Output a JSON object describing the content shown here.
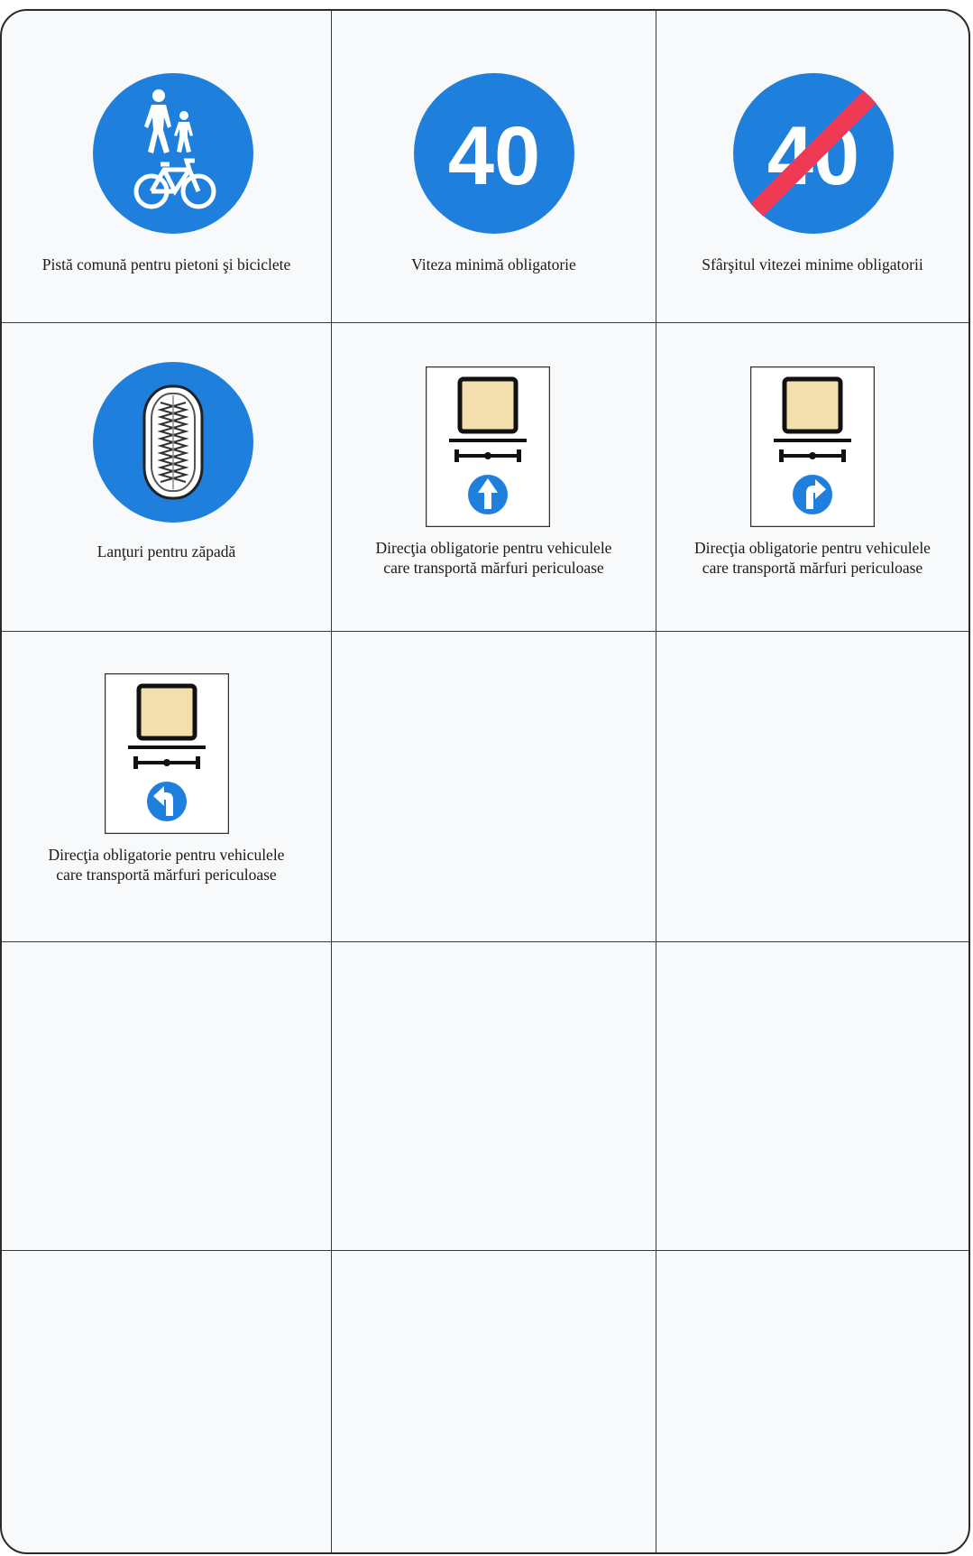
{
  "colors": {
    "sign_blue": "#1f7fdc",
    "end_stripe_red": "#f03a55",
    "cargo_fill": "#f3dfad",
    "border": "#2a2a2a",
    "background": "#f7f9fa"
  },
  "signs": [
    {
      "icon": "pedestrian-and-bicycle-icon",
      "caption_lines": [
        "Pistă comună pentru pietoni şi biciclete"
      ]
    },
    {
      "icon": "minimum-speed-icon",
      "speed": "40",
      "caption_lines": [
        "Viteza minimă obligatorie"
      ]
    },
    {
      "icon": "end-minimum-speed-icon",
      "speed": "40",
      "caption_lines": [
        "Sfârşitul vitezei minime obligatorii"
      ]
    },
    {
      "icon": "snow-chains-icon",
      "caption_lines": [
        "Lanţuri pentru zăpadă"
      ]
    },
    {
      "icon": "dangerous-goods-straight-icon",
      "caption_lines": [
        "Direcţia obligatorie pentru vehiculele",
        "care transportă mărfuri periculoase"
      ]
    },
    {
      "icon": "dangerous-goods-right-icon",
      "caption_lines": [
        "Direcţia obligatorie pentru vehiculele",
        "care transportă mărfuri periculoase"
      ]
    },
    {
      "icon": "dangerous-goods-left-icon",
      "caption_lines": [
        "Direcţia obligatorie pentru vehiculele",
        "care transportă mărfuri periculoase"
      ]
    }
  ]
}
